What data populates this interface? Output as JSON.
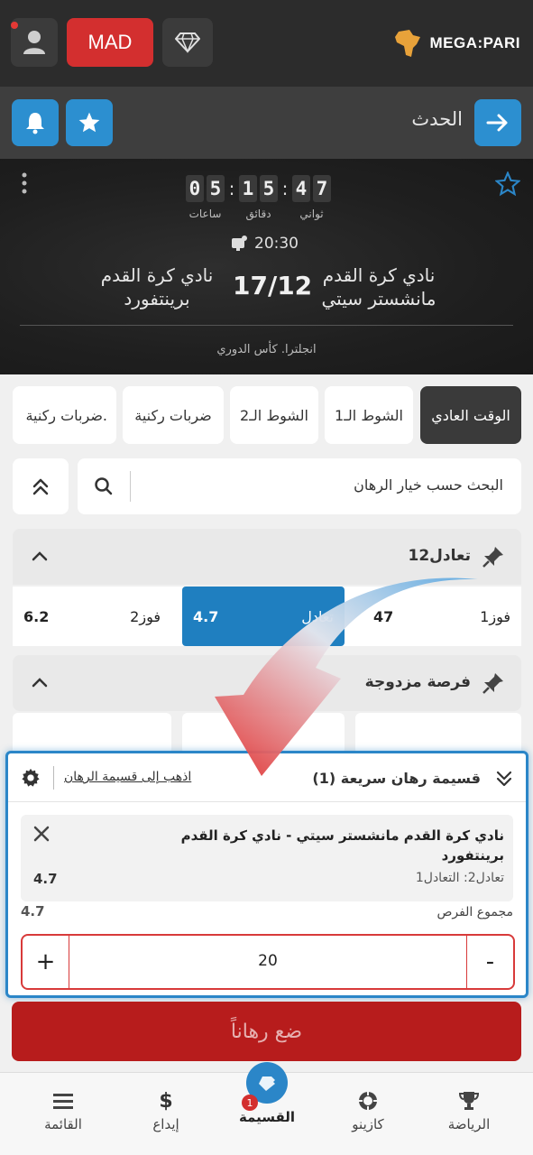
{
  "topbar": {
    "currency_label": "MAD",
    "logo_text": "MEGA:PARI",
    "icons": [
      "user-icon",
      "diamond-icon",
      "africa-logo-icon"
    ]
  },
  "event_bar": {
    "title": "الحدث",
    "icons": [
      "bell-icon",
      "star-icon",
      "arrow-right-icon"
    ]
  },
  "match": {
    "timer": {
      "hours": [
        "0",
        "5"
      ],
      "minutes": [
        "1",
        "5"
      ],
      "seconds": [
        "4",
        "7"
      ],
      "hours_label": "ساعات",
      "minutes_label": "دقائق",
      "seconds_label": "ثواني"
    },
    "time": "20:30",
    "home_team": "نادي كرة القدم مانشستر سيتي",
    "away_team": "نادي كرة القدم برينتفورد",
    "score": "17/12",
    "league": "انجلترا. كأس الدوري"
  },
  "tabs": [
    {
      "label": "الوقت العادي",
      "active": true
    },
    {
      "label": "الشوط الـ1"
    },
    {
      "label": "الشوط الـ2"
    },
    {
      "label": "ضربات ركنية"
    },
    {
      "label": "ضربات ركنية."
    }
  ],
  "search": {
    "placeholder": "البحث حسب خيار الرهان"
  },
  "markets": [
    {
      "title": "1تعادل2",
      "odds": [
        {
          "label": "فوز1",
          "value": "47"
        },
        {
          "label": "تعادل",
          "value": "4.7"
        },
        {
          "label": "فوز2",
          "value": "6.2"
        }
      ]
    },
    {
      "title": "فرصة مزدوجة"
    }
  ],
  "slip": {
    "title": "قسيمة رهان سريعة (1)",
    "link": "اذهب إلى قسيمة الرهان",
    "bet_teams": "نادي كرة القدم مانشستر سيتي - نادي كرة القدم برينتفورد",
    "bet_market": "1تعادل2: التعادل",
    "bet_odd": "4.7",
    "total_label": "مجموع الفرص",
    "total_value": "4.7",
    "stake": "20",
    "plus": "+",
    "minus": "-"
  },
  "place_bet": "ضع رهاناً",
  "nav": {
    "sports": "الرياضة",
    "casino": "كازينو",
    "slip": "القسيمة",
    "slip_count": "1",
    "deposit": "إيداع",
    "menu": "القائمة"
  },
  "colors": {
    "accent_blue": "#2b86c8",
    "red": "#d32f2f",
    "dark": "#2c2c2c"
  }
}
